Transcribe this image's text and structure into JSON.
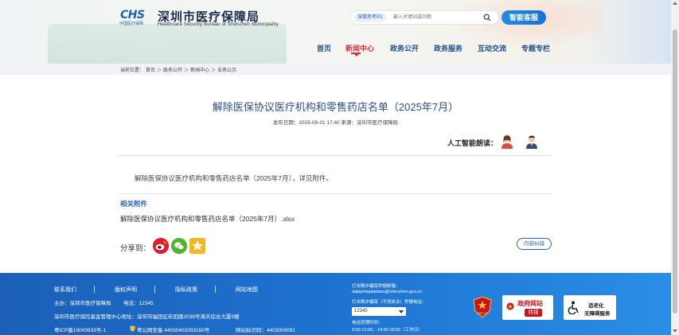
{
  "header": {
    "logo_text": "CHS",
    "logo_sub": "中国医疗保障",
    "site_title": "深圳市医疗保障局",
    "site_subtitle": "Healthcare Security Bureau of Shenzhen Municipality",
    "search_tag": "深度思考R1",
    "search_placeholder": "输入关键词或问题",
    "smart_service": "智能客服"
  },
  "nav": {
    "items": [
      {
        "label": "首页"
      },
      {
        "label": "新闻中心"
      },
      {
        "label": "政务公开"
      },
      {
        "label": "政务服务"
      },
      {
        "label": "互动交流"
      },
      {
        "label": "专题专栏"
      }
    ],
    "active_index": 1
  },
  "breadcrumb": {
    "prefix": "当前位置：",
    "items": [
      "首页",
      "政务公开",
      "新闻中心",
      "业务公示"
    ],
    "separator": "＞"
  },
  "article": {
    "title": "解除医保协议医疗机构和零售药店名单（2025年7月）",
    "meta": "发布日期：2025-09-01 17:40 来源：深圳市医疗保障局",
    "ai_read_label": "人工智能朗读：",
    "body": "解除医保协议医疗机构和零售药店名单（2025年7月），详见附件。",
    "attachments_title": "相关附件",
    "attachment_name": "解除医保协议医疗机构和零售药店名单（2025年7月）.xlsx",
    "share_label": "分享到：",
    "correct_label": "内容纠错"
  },
  "footer": {
    "links": [
      "联系我们",
      "版权声明",
      "隐私政策",
      "网站地图"
    ],
    "host": "主办：深圳市医疗保障局",
    "phone": "电话：12345",
    "address": "深圳市医疗保险基金管理中心地址：深圳市福田区彩田路2038号海天综合大厦9楼",
    "icp": "粤ICP备19043933号-1",
    "police": "粤公网安备 44030402003150号",
    "site_code": "网站标识码：4403000091",
    "email_label": "打击欺诈骗保举报邮箱：",
    "email": "dajiqizhapianbao@shenzhen.gov.cn",
    "hotline_label": "打击欺诈骗保（不良执业）举报电话：",
    "hotline_value": "12345",
    "hours_label": "电话受理时间：",
    "hours": "9:00-12:00、14:00-18:00（工作日）",
    "gov_badge_top": "政府网站",
    "gov_badge_bottom": "找错",
    "access_badge_top": "适老化",
    "access_badge_bottom": "无障碍服务",
    "emblem_text": "深圳公安"
  },
  "colors": {
    "brand_blue": "#1d64b5",
    "nav_blue": "#1d4d8c",
    "nav_active": "#d4343c",
    "footer_blue": "#1e73d0",
    "smart_btn": "#1b8de8"
  }
}
